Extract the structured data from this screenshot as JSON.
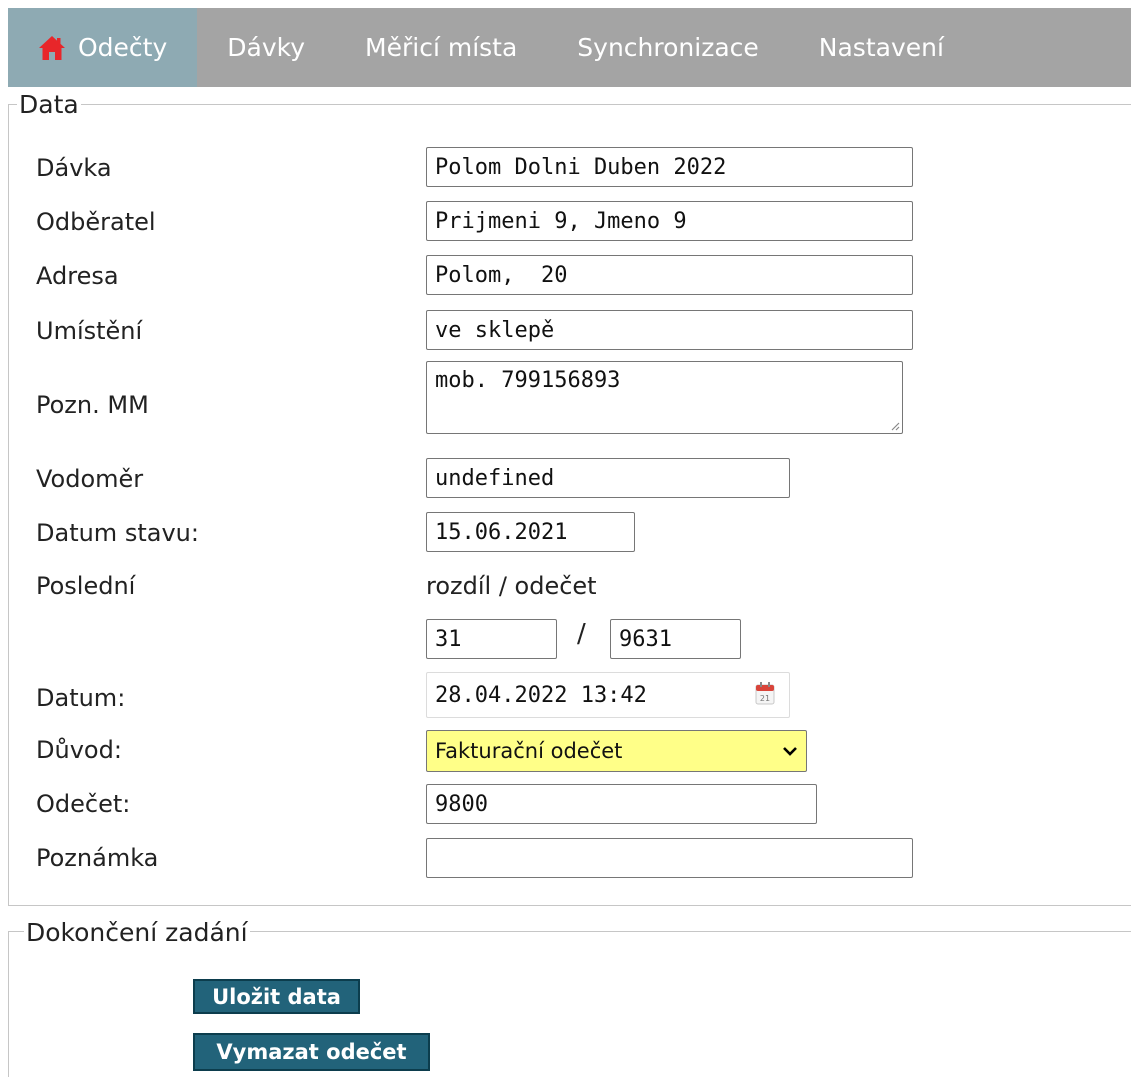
{
  "nav": {
    "items": [
      {
        "label": "Odečty",
        "active": true,
        "icon": "home-icon"
      },
      {
        "label": "Dávky"
      },
      {
        "label": "Měřicí místa"
      },
      {
        "label": "Synchronizace"
      },
      {
        "label": "Nastavení"
      }
    ]
  },
  "data_section": {
    "legend": "Data",
    "fields": {
      "davka": {
        "label": "Dávka",
        "value": "Polom Dolni Duben 2022"
      },
      "odberatel": {
        "label": "Odběratel",
        "value": "Prijmeni 9, Jmeno 9"
      },
      "adresa": {
        "label": "Adresa",
        "value": "Polom,  20"
      },
      "umisteni": {
        "label": "Umístění",
        "value": "ve sklepě"
      },
      "pozn_mm": {
        "label": "Pozn. MM",
        "value": "mob. 799156893"
      },
      "vodomer": {
        "label": "Vodoměr",
        "value": "undefined"
      },
      "datum_stavu": {
        "label": "Datum stavu:",
        "value": "15.06.2021"
      },
      "posledni": {
        "label": "Poslední",
        "sublabel": "rozdíl / odečet",
        "rozdil": "31",
        "odecet": "9631",
        "separator": "/"
      },
      "datum": {
        "label": "Datum:",
        "value": "28.04.2022 13:42",
        "icon": "calendar-icon"
      },
      "duvod": {
        "label": "Důvod:",
        "value": "Fakturační odečet"
      },
      "odecet": {
        "label": "Odečet:",
        "value": "9800"
      },
      "poznamka": {
        "label": "Poznámka",
        "value": ""
      }
    }
  },
  "finish_section": {
    "legend": "Dokončení zadání",
    "save_label": "Uložit data",
    "delete_label": "Vymazat odečet"
  },
  "colors": {
    "nav_bg": "#a4a4a4",
    "nav_active": "#8eaab3",
    "select_bg": "#ffff88",
    "button_bg": "#22637a",
    "home_icon": "#e8262a"
  }
}
